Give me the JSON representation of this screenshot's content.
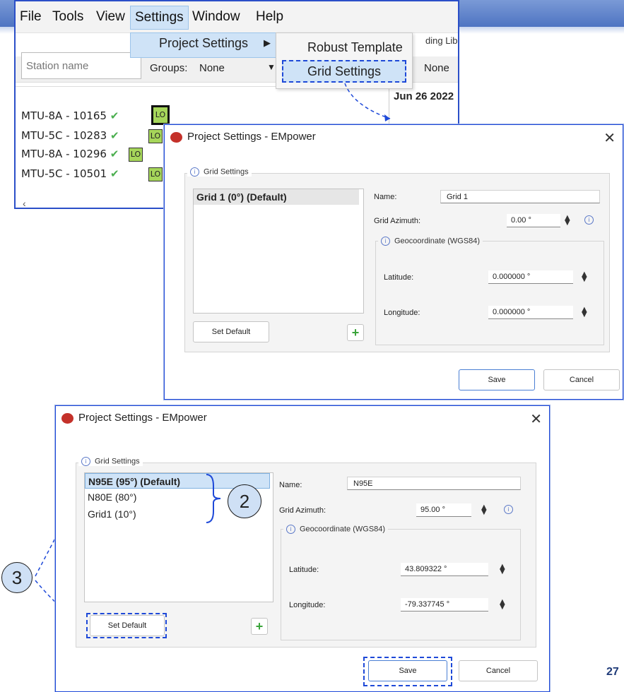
{
  "app": {
    "menus": [
      "File",
      "Tools",
      "View",
      "Settings",
      "Window",
      "Help"
    ],
    "submenu_project_settings": "Project Settings",
    "submenu_items": [
      "Robust Template",
      "Grid Settings"
    ],
    "station_placeholder": "Station name",
    "groups_label": "Groups:",
    "groups_value": "None",
    "right_none": "None",
    "right_lib": "ding Lib",
    "date_header": "Jun 26 2022",
    "stations": [
      "MTU-8A - 10165",
      "MTU-5C - 10283",
      "MTU-8A - 10296",
      "MTU-5C - 10501"
    ],
    "lo_label": "LO"
  },
  "dialog1": {
    "title": "Project Settings - EMpower",
    "group_title": "Grid Settings",
    "grids": [
      "Grid 1 (0°) (Default)"
    ],
    "name_label": "Name:",
    "name_value": "Grid 1",
    "azimuth_label": "Grid Azimuth:",
    "azimuth_value": "0.00 °",
    "geo_title": "Geocoordinate (WGS84)",
    "lat_label": "Latitude:",
    "lat_value": "0.000000 °",
    "lon_label": "Longitude:",
    "lon_value": "0.000000 °",
    "set_default": "Set Default",
    "save": "Save",
    "cancel": "Cancel"
  },
  "dialog2": {
    "title": "Project Settings - EMpower",
    "group_title": "Grid Settings",
    "grids": [
      "N95E (95°) (Default)",
      "N80E (80°)",
      "Grid1 (10°)"
    ],
    "name_label": "Name:",
    "name_value": "N95E",
    "azimuth_label": "Grid Azimuth:",
    "azimuth_value": "95.00 °",
    "geo_title": "Geocoordinate (WGS84)",
    "lat_label": "Latitude:",
    "lat_value": "43.809322 °",
    "lon_label": "Longitude:",
    "lon_value": "-79.337745 °",
    "set_default": "Set Default",
    "save": "Save",
    "cancel": "Cancel"
  },
  "callouts": {
    "two": "2",
    "three": "3"
  },
  "icons": {
    "close": "close-icon",
    "info": "info-icon",
    "plus": "plus-icon",
    "spin": "spin-arrows-icon",
    "check": "check-icon",
    "app": "empower-logo-icon"
  },
  "colors": {
    "accent": "#1e49d8",
    "band": "#5a7fc7",
    "check": "#4caf50",
    "lo": "#a6d65a"
  },
  "page_number": "27"
}
